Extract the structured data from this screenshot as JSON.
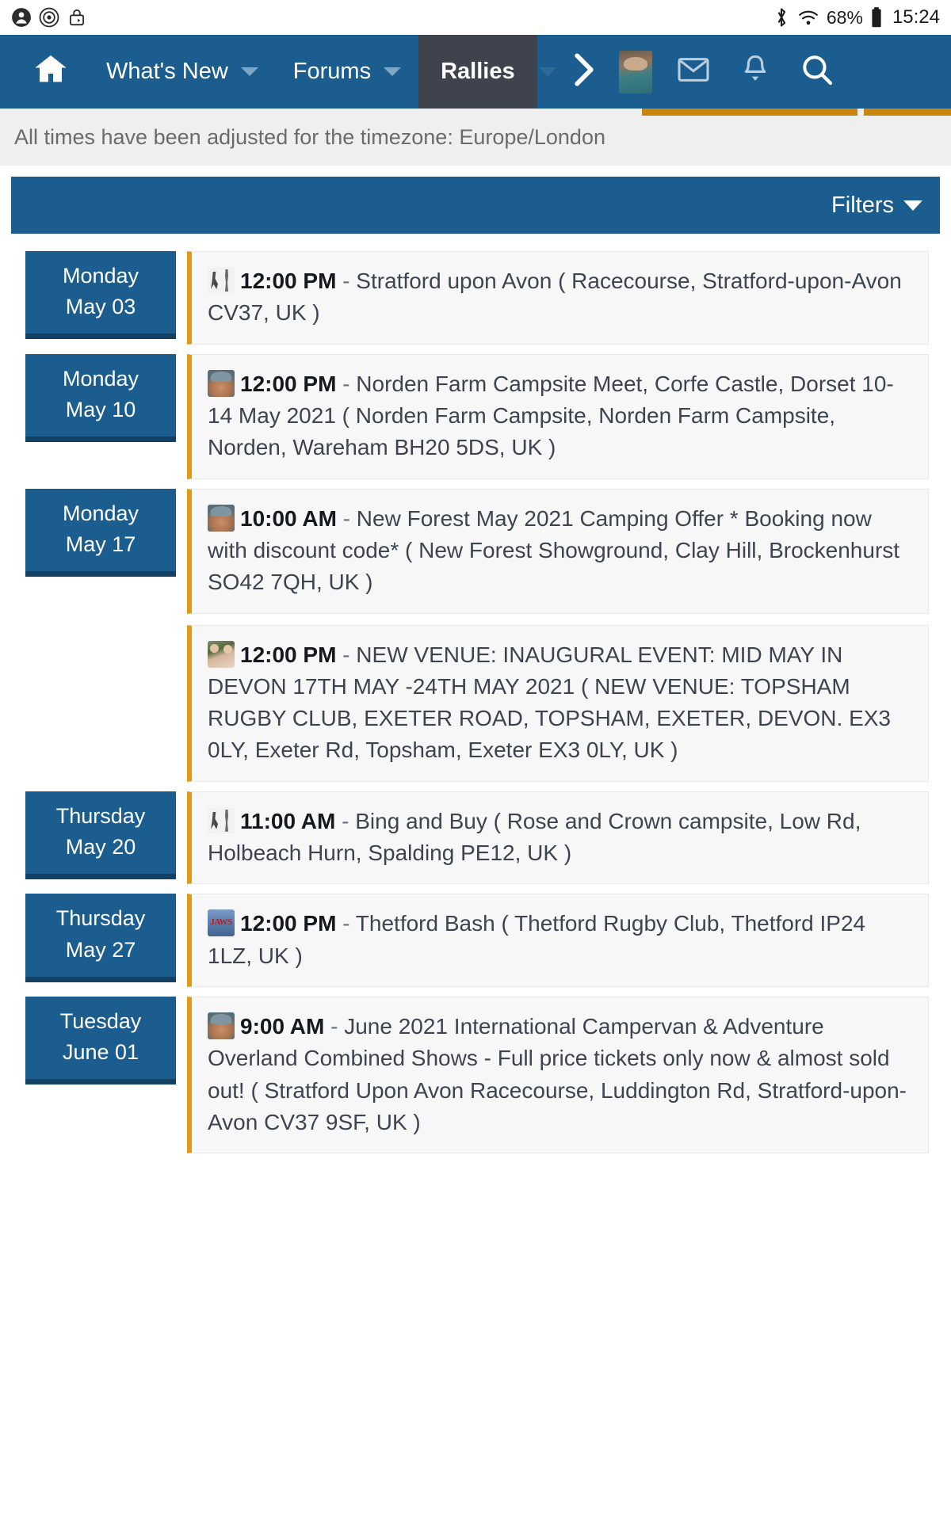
{
  "statusbar": {
    "left_icons": [
      "person-icon",
      "record-icon",
      "lock-rotate-icon"
    ],
    "bluetooth_icon": "bluetooth-icon",
    "wifi_icon": "wifi-icon",
    "battery_percent": "68%",
    "battery_icon": "battery-icon",
    "clock": "15:24"
  },
  "nav": {
    "home_icon": "home-icon",
    "items": [
      {
        "label": "What's New",
        "has_caret": true,
        "active": false
      },
      {
        "label": "Forums",
        "has_caret": true,
        "active": false
      },
      {
        "label": "Rallies",
        "has_caret": true,
        "active": true
      }
    ],
    "chevron_icon": "chevron-right-icon",
    "avatar": "user-avatar",
    "mail_icon": "mail-icon",
    "bell_icon": "bell-icon",
    "search_icon": "search-icon",
    "accent_color": "#c8860d",
    "bar_color": "#1c5d8f",
    "active_color": "#3e434e"
  },
  "notice": {
    "text": "All times have been adjusted for the timezone: Europe/London"
  },
  "filters": {
    "label": "Filters",
    "caret_icon": "caret-down-icon"
  },
  "days": [
    {
      "weekday": "Monday",
      "date": "May 03",
      "events": [
        {
          "avatar": "av-lineart",
          "time": "12:00 PM",
          "dash": " - ",
          "title": "Stratford upon Avon ( Racecourse, Stratford-upon-Avon CV37, UK )"
        }
      ]
    },
    {
      "weekday": "Monday",
      "date": "May 10",
      "events": [
        {
          "avatar": "av-hedge",
          "time": "12:00 PM",
          "dash": " - ",
          "title": "Norden Farm Campsite Meet, Corfe Castle, Dorset 10-14 May 2021 ( Norden Farm Campsite, Norden Farm Campsite, Norden, Wareham BH20 5DS, UK )"
        }
      ]
    },
    {
      "weekday": "Monday",
      "date": "May 17",
      "events": [
        {
          "avatar": "av-hedge",
          "time": "10:00 AM",
          "dash": " - ",
          "title": "New Forest May 2021 Camping Offer * Booking now with discount code* ( New Forest Showground, Clay Hill, Brockenhurst SO42 7QH, UK )"
        },
        {
          "avatar": "av-couple",
          "time": "12:00 PM",
          "dash": " - ",
          "title": "NEW VENUE: INAUGURAL EVENT: MID MAY IN DEVON 17TH MAY -24TH MAY 2021 ( NEW VENUE: TOPSHAM RUGBY CLUB, EXETER ROAD, TOPSHAM, EXETER, DEVON. EX3 0LY, Exeter Rd, Topsham, Exeter EX3 0LY, UK )"
        }
      ]
    },
    {
      "weekday": "Thursday",
      "date": "May 20",
      "events": [
        {
          "avatar": "av-lineart",
          "time": "11:00 AM",
          "dash": " - ",
          "title": "Bing and Buy ( Rose and Crown campsite, Low Rd, Holbeach Hurn, Spalding PE12, UK )"
        }
      ]
    },
    {
      "weekday": "Thursday",
      "date": "May 27",
      "events": [
        {
          "avatar": "av-jaws",
          "time": "12:00 PM",
          "dash": " - ",
          "title": "Thetford Bash ( Thetford Rugby Club, Thetford IP24 1LZ, UK )"
        }
      ]
    },
    {
      "weekday": "Tuesday",
      "date": "June 01",
      "events": [
        {
          "avatar": "av-hedge",
          "time": "9:00 AM",
          "dash": " - ",
          "title": "June 2021 International Campervan & Adventure Overland Combined Shows - Full price tickets only now & almost sold out! ( Stratford Upon Avon Racecourse, Luddington Rd, Stratford-upon-Avon CV37 9SF, UK )"
        }
      ]
    }
  ]
}
